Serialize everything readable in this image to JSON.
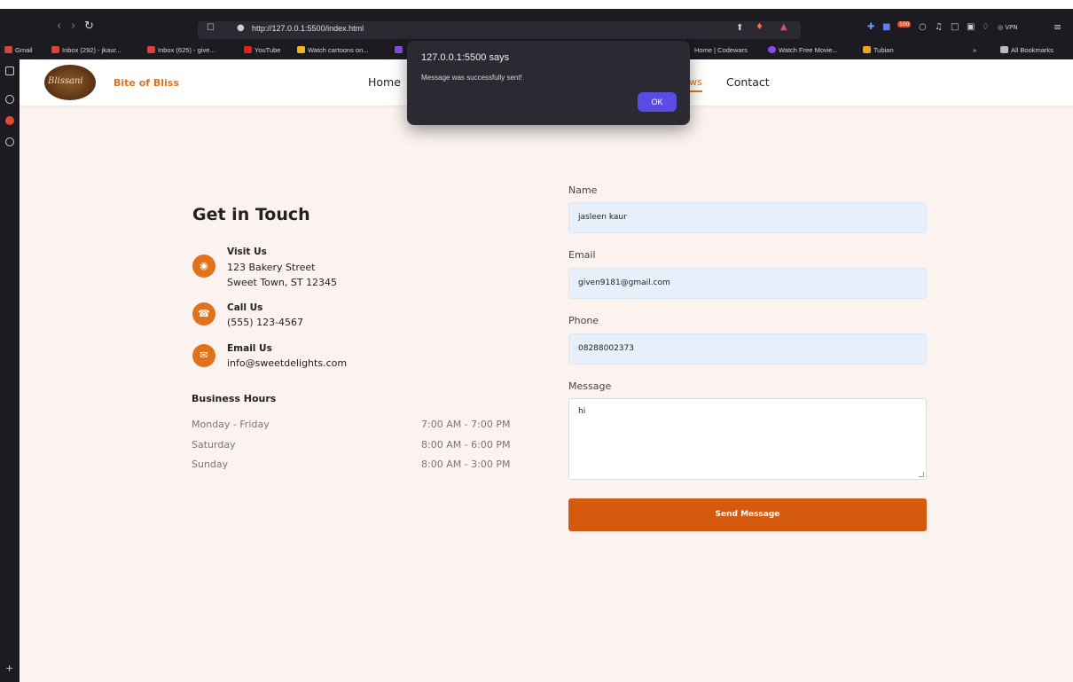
{
  "browser": {
    "url": "http://127.0.0.1:5500/index.html",
    "vpn_label": "VPN",
    "badge_count": "100",
    "bookmarks": [
      "Gmail",
      "Inbox (292) - jkaur...",
      "Inbox (625) - give...",
      "YouTube",
      "Watch cartoons on...",
      "Home | Codewars",
      "Watch Free Movie...",
      "Tubian",
      "»",
      "All Bookmarks"
    ]
  },
  "site": {
    "brand": "Bite of Bliss",
    "logo_text": "Blissani",
    "nav": [
      "Home",
      "ws",
      "Contact"
    ]
  },
  "alert": {
    "title": "127.0.0.1:5500 says",
    "message": "Message was successfully sent!",
    "ok_label": "OK"
  },
  "contact": {
    "title": "Get in Touch",
    "visit_title": "Visit Us",
    "visit_line1": "123 Bakery Street",
    "visit_line2": "Sweet Town, ST 12345",
    "call_title": "Call Us",
    "call_phone": "(555) 123-4567",
    "email_title": "Email Us",
    "email_addr": "info@sweetdelights.com",
    "hours_title": "Business Hours",
    "hours": [
      {
        "day": "Monday - Friday",
        "time": "7:00 AM - 7:00 PM"
      },
      {
        "day": "Saturday",
        "time": "8:00 AM - 6:00 PM"
      },
      {
        "day": "Sunday",
        "time": "8:00 AM - 3:00 PM"
      }
    ]
  },
  "form": {
    "name_label": "Name",
    "name_value": "jasleen kaur",
    "email_label": "Email",
    "email_value": "given9181@gmail.com",
    "phone_label": "Phone",
    "phone_value": "08288002373",
    "message_label": "Message",
    "message_value": "hi",
    "send_label": "Send Message"
  },
  "colors": {
    "accent": "#e0721c",
    "button": "#d45a0f",
    "page_bg": "#fcf3f0",
    "dialog_ok": "#5b4ce6"
  }
}
